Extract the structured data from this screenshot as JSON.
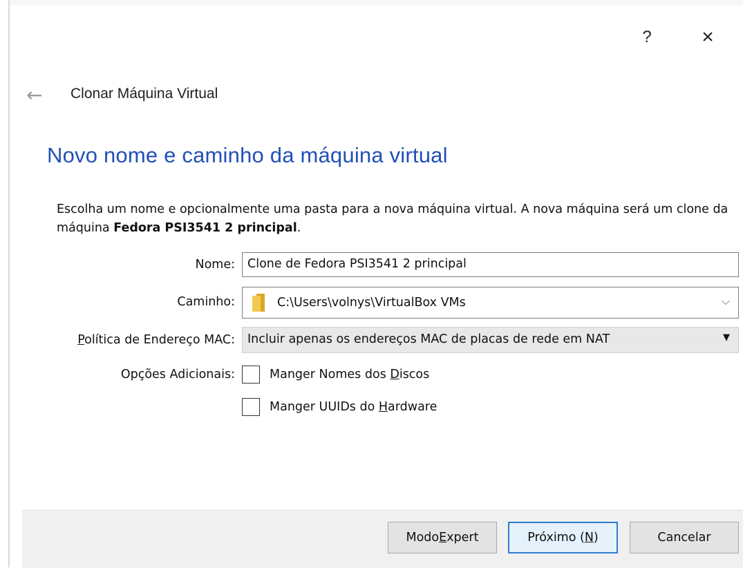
{
  "window": {
    "help_label": "?",
    "close_label": "×"
  },
  "wizard": {
    "back_arrow": "←",
    "title": "Clonar Máquina Virtual",
    "heading": "Novo nome e caminho da máquina virtual",
    "description_prefix": "Escolha um nome e opcionalmente uma pasta para a nova máquina virtual. A nova máquina será um clone da máquina ",
    "description_bold": "Fedora PSI3541 2 principal",
    "description_suffix": "."
  },
  "form": {
    "name_label": "Nome:",
    "name_value": "Clone de Fedora PSI3541 2 principal",
    "path_label": "Caminho:",
    "path_value": "C:\\Users\\volnys\\VirtualBox VMs",
    "path_chevron": "⌵",
    "mac_label_first": "P",
    "mac_label_rest": "olítica de Endereço MAC:",
    "mac_value": "Incluir apenas os endereços MAC de placas de rede em NAT",
    "mac_arrow": "▼",
    "options_label": "Opções Adicionais:",
    "option1_pre": "Manger Nomes dos ",
    "option1_key": "D",
    "option1_post": "iscos",
    "option1_checked": false,
    "option2_pre": "Manger UUIDs do ",
    "option2_key": "H",
    "option2_post": "ardware",
    "option2_checked": false
  },
  "buttons": {
    "expert_pre": "Modo ",
    "expert_key": "E",
    "expert_post": "xpert",
    "next_pre": "Próximo (",
    "next_key": "N",
    "next_post": ")",
    "cancel": "Cancelar"
  },
  "colors": {
    "heading": "#2250b8",
    "focus_border": "#2f7ad0",
    "folder": "#f2c94c"
  }
}
